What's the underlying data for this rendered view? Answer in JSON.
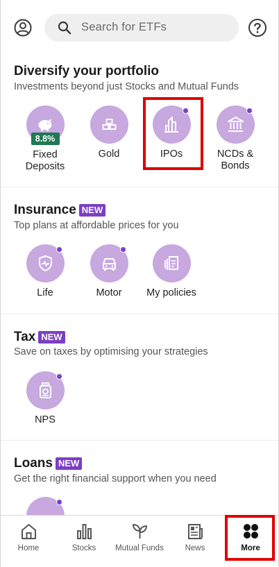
{
  "header": {
    "search_placeholder": "Search for ETFs",
    "profile_icon": "account-circle-icon",
    "help_icon": "help-circle-icon"
  },
  "colors": {
    "accent": "#7b3fc4",
    "tile_bg": "#c7a8df",
    "rate_badge_bg": "#1f7a54",
    "highlight": "#e00000"
  },
  "diversify": {
    "title": "Diversify your portfolio",
    "subtitle": "Investments beyond just Stocks and Mutual Funds",
    "items": [
      {
        "label": "Fixed\nDeposits",
        "badge": "8.8%",
        "icon": "piggy-bank-icon"
      },
      {
        "label": "Gold",
        "icon": "gold-bars-icon"
      },
      {
        "label": "IPOs",
        "icon": "buildings-icon"
      },
      {
        "label": "NCDs &\nBonds",
        "icon": "bank-icon"
      }
    ]
  },
  "insurance": {
    "title": "Insurance",
    "badge": "NEW",
    "subtitle": "Top plans at affordable prices for you",
    "items": [
      {
        "label": "Life",
        "icon": "heart-shield-icon"
      },
      {
        "label": "Motor",
        "icon": "car-icon"
      },
      {
        "label": "My policies",
        "icon": "policies-icon"
      }
    ]
  },
  "tax": {
    "title": "Tax",
    "badge": "NEW",
    "subtitle": "Save on taxes by optimising your strategies",
    "items": [
      {
        "label": "NPS",
        "icon": "jar-icon"
      }
    ]
  },
  "loans": {
    "title": "Loans",
    "badge": "NEW",
    "subtitle": "Get the right financial support when you need"
  },
  "nav": {
    "items": [
      {
        "label": "Home",
        "icon": "home-icon"
      },
      {
        "label": "Stocks",
        "icon": "bar-chart-icon"
      },
      {
        "label": "Mutual Funds",
        "icon": "sprout-icon"
      },
      {
        "label": "News",
        "icon": "newspaper-icon"
      },
      {
        "label": "More",
        "icon": "four-dots-icon",
        "active": true
      }
    ]
  }
}
